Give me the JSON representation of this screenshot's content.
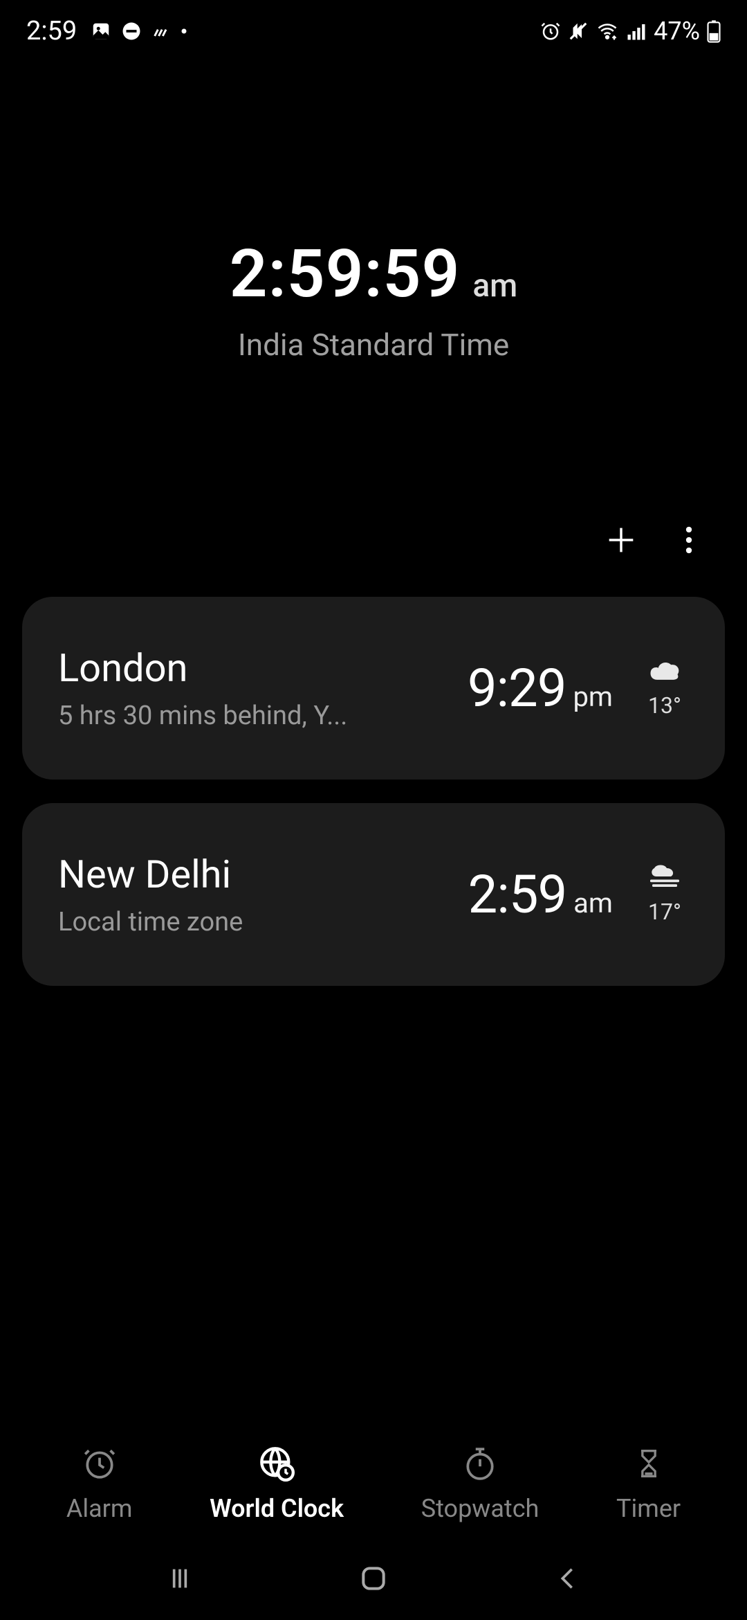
{
  "status": {
    "time": "2:59",
    "battery": "47%"
  },
  "hero": {
    "time": "2:59:59",
    "ampm": "am",
    "zone": "India Standard Time"
  },
  "cities": [
    {
      "name": "London",
      "sub": "5 hrs 30 mins behind, Y...",
      "time": "9:29",
      "ampm": "pm",
      "temp": "13°",
      "weather": "cloudy"
    },
    {
      "name": "New Delhi",
      "sub": "Local time zone",
      "time": "2:59",
      "ampm": "am",
      "temp": "17°",
      "weather": "fog"
    }
  ],
  "tabs": {
    "alarm": "Alarm",
    "world": "World Clock",
    "stopwatch": "Stopwatch",
    "timer": "Timer"
  }
}
